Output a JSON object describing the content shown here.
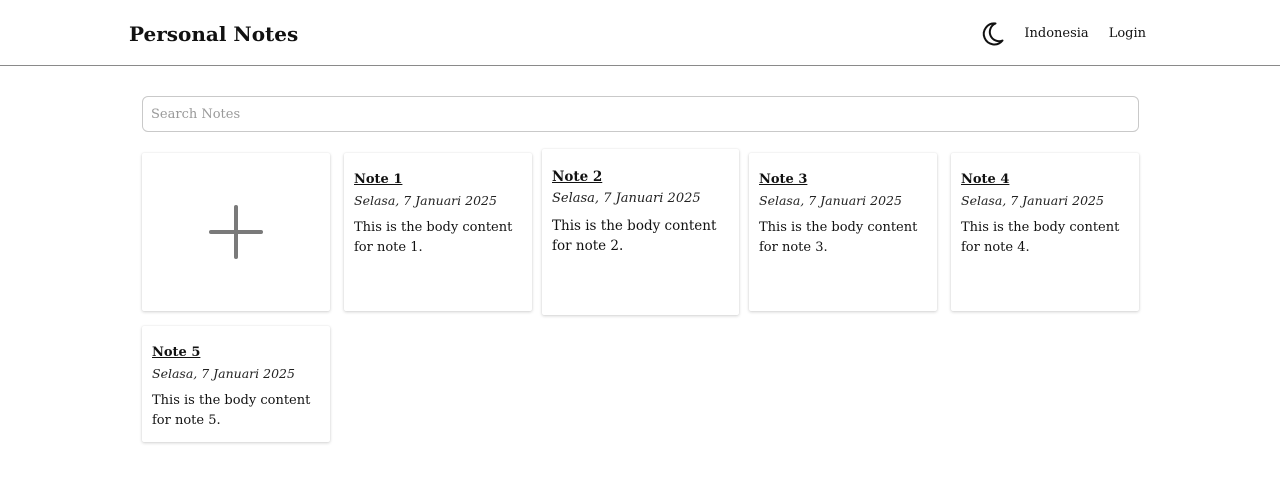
{
  "header": {
    "title": "Personal Notes",
    "theme_icon": "moon-icon",
    "language_label": "Indonesia",
    "login_label": "Login"
  },
  "search": {
    "placeholder": "Search Notes",
    "value": ""
  },
  "add_card": {
    "icon": "plus-icon"
  },
  "notes": [
    {
      "title": "Note 1",
      "date": "Selasa, 7 Januari 2025",
      "body": "This is the body content for note 1."
    },
    {
      "title": "Note 2",
      "date": "Selasa, 7 Januari 2025",
      "body": "This is the body content for note 2."
    },
    {
      "title": "Note 3",
      "date": "Selasa, 7 Januari 2025",
      "body": "This is the body content for note 3."
    },
    {
      "title": "Note 4",
      "date": "Selasa, 7 Januari 2025",
      "body": "This is the body content for note 4."
    },
    {
      "title": "Note 5",
      "date": "Selasa, 7 Januari 2025",
      "body": "This is the body content for note 5."
    }
  ]
}
